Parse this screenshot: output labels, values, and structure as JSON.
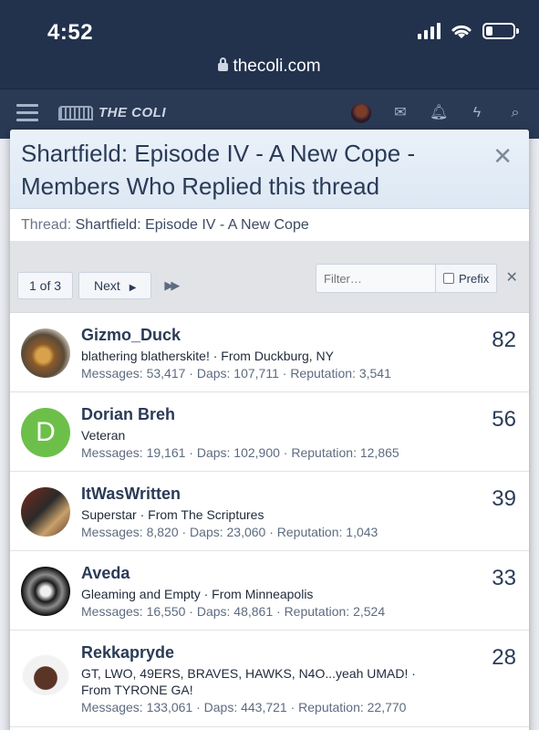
{
  "status_bar": {
    "time": "4:52",
    "url": "thecoli.com"
  },
  "site_header": {
    "logo_text": "THE COLI"
  },
  "modal": {
    "title": "Shartfield: Episode IV - A New Cope - Members Who Replied this thread",
    "thread_label": "Thread:",
    "thread_title": "Shartfield: Episode IV - A New Cope",
    "pager": {
      "current": "1 of 3",
      "next_label": "Next"
    },
    "filter": {
      "placeholder": "Filter…",
      "prefix_label": "Prefix"
    },
    "members": [
      {
        "name": "Gizmo_Duck",
        "title": "blathering blatherskite! · From Duckburg, NY",
        "stats": "Messages: 53,417 · Daps: 107,711 · Reputation: 3,541",
        "count": "82"
      },
      {
        "name": "Dorian Breh",
        "avatar_letter": "D",
        "title": "Veteran",
        "stats": "Messages: 19,161 · Daps: 102,900 · Reputation: 12,865",
        "count": "56"
      },
      {
        "name": "ItWasWritten",
        "title": "Superstar · From The Scriptures",
        "stats": "Messages: 8,820 · Daps: 23,060 · Reputation: 1,043",
        "count": "39"
      },
      {
        "name": "Aveda",
        "title": "Gleaming and Empty · From Minneapolis",
        "stats": "Messages: 16,550 · Daps: 48,861 · Reputation: 2,524",
        "count": "33"
      },
      {
        "name": "Rekkapryde",
        "title": "GT, LWO, 49ERS, BRAVES, HAWKS, N4O...yeah UMAD! · From TYRONE GA!",
        "stats": "Messages: 133,061 · Daps: 443,721 · Reputation: 22,770",
        "count": "28"
      }
    ]
  }
}
